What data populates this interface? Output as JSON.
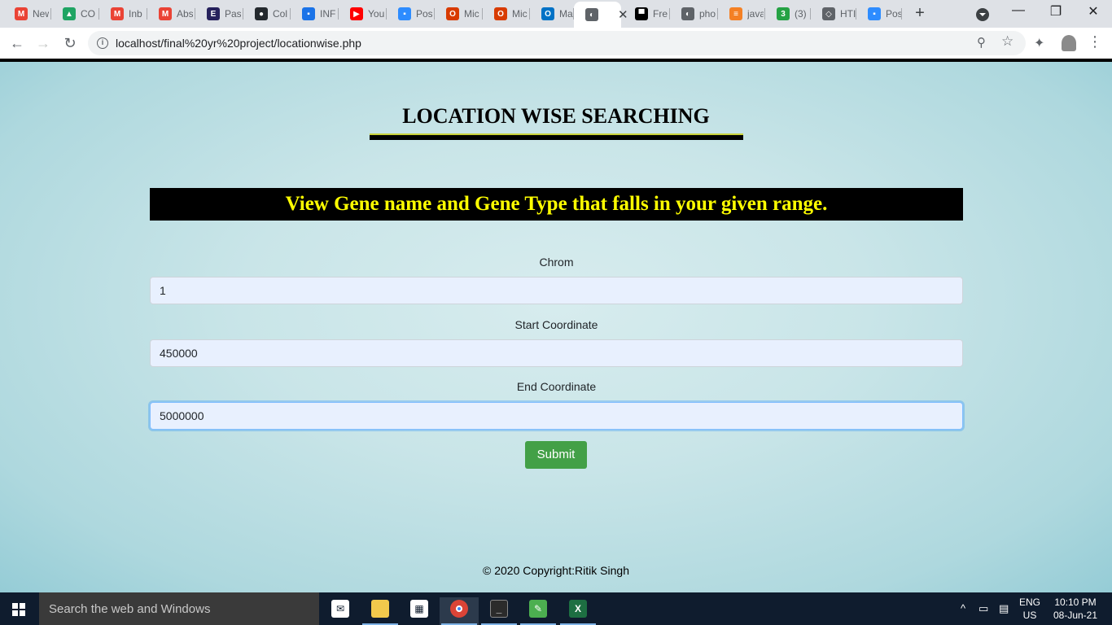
{
  "browser": {
    "tabs": [
      {
        "title": "New",
        "icon": "gmail-icon",
        "color": "#ea4335",
        "glyph": "M"
      },
      {
        "title": "CO",
        "icon": "drive-icon",
        "color": "#1fa463",
        "glyph": "▲"
      },
      {
        "title": "Inb",
        "icon": "gmail-icon",
        "color": "#ea4335",
        "glyph": "M"
      },
      {
        "title": "Abs",
        "icon": "gmail-icon",
        "color": "#ea4335",
        "glyph": "M"
      },
      {
        "title": "Pas",
        "icon": "site-icon",
        "color": "#26215c",
        "glyph": "E"
      },
      {
        "title": "Col",
        "icon": "github-icon",
        "color": "#24292e",
        "glyph": "●"
      },
      {
        "title": "INF",
        "icon": "contact-icon",
        "color": "#1a73e8",
        "glyph": "▪"
      },
      {
        "title": "You",
        "icon": "youtube-icon",
        "color": "#ff0000",
        "glyph": "▶"
      },
      {
        "title": "Pos",
        "icon": "zoom-icon",
        "color": "#2d8cff",
        "glyph": "▪"
      },
      {
        "title": "Mic",
        "icon": "office-icon",
        "color": "#d83b01",
        "glyph": "O"
      },
      {
        "title": "Mic",
        "icon": "office-icon",
        "color": "#d83b01",
        "glyph": "O"
      },
      {
        "title": "Ma",
        "icon": "outlook-icon",
        "color": "#0072c6",
        "glyph": "O"
      },
      {
        "title": "",
        "icon": "globe-icon",
        "color": "#5f6368",
        "glyph": "◐",
        "active": true
      },
      {
        "title": "Fre",
        "icon": "site-icon",
        "color": "#000000",
        "glyph": "▀"
      },
      {
        "title": "pho",
        "icon": "globe-icon",
        "color": "#5f6368",
        "glyph": "◐"
      },
      {
        "title": "java",
        "icon": "stackoverflow-icon",
        "color": "#f48024",
        "glyph": "≡"
      },
      {
        "title": "(3)",
        "icon": "badge-icon",
        "color": "#25a244",
        "glyph": "3"
      },
      {
        "title": "HTI",
        "icon": "site-icon",
        "color": "#5f6368",
        "glyph": "◇"
      },
      {
        "title": "Pos",
        "icon": "zoom-icon",
        "color": "#2d8cff",
        "glyph": "▪"
      }
    ],
    "url": "localhost/final%20yr%20project/locationwise.php"
  },
  "page": {
    "heading": "LOCATION WISE SEARCHING",
    "banner": "View Gene name and Gene Type that falls in your given range.",
    "fields": {
      "chrom": {
        "label": "Chrom",
        "value": "1"
      },
      "start": {
        "label": "Start Coordinate",
        "value": "450000"
      },
      "end": {
        "label": "End Coordinate",
        "value": "5000000"
      }
    },
    "submit_label": "Submit",
    "footer": "© 2020 Copyright:Ritik Singh"
  },
  "taskbar": {
    "search_placeholder": "Search the web and Windows",
    "lang_line1": "ENG",
    "lang_line2": "US",
    "time": "10:10 PM",
    "date": "08-Jun-21"
  }
}
